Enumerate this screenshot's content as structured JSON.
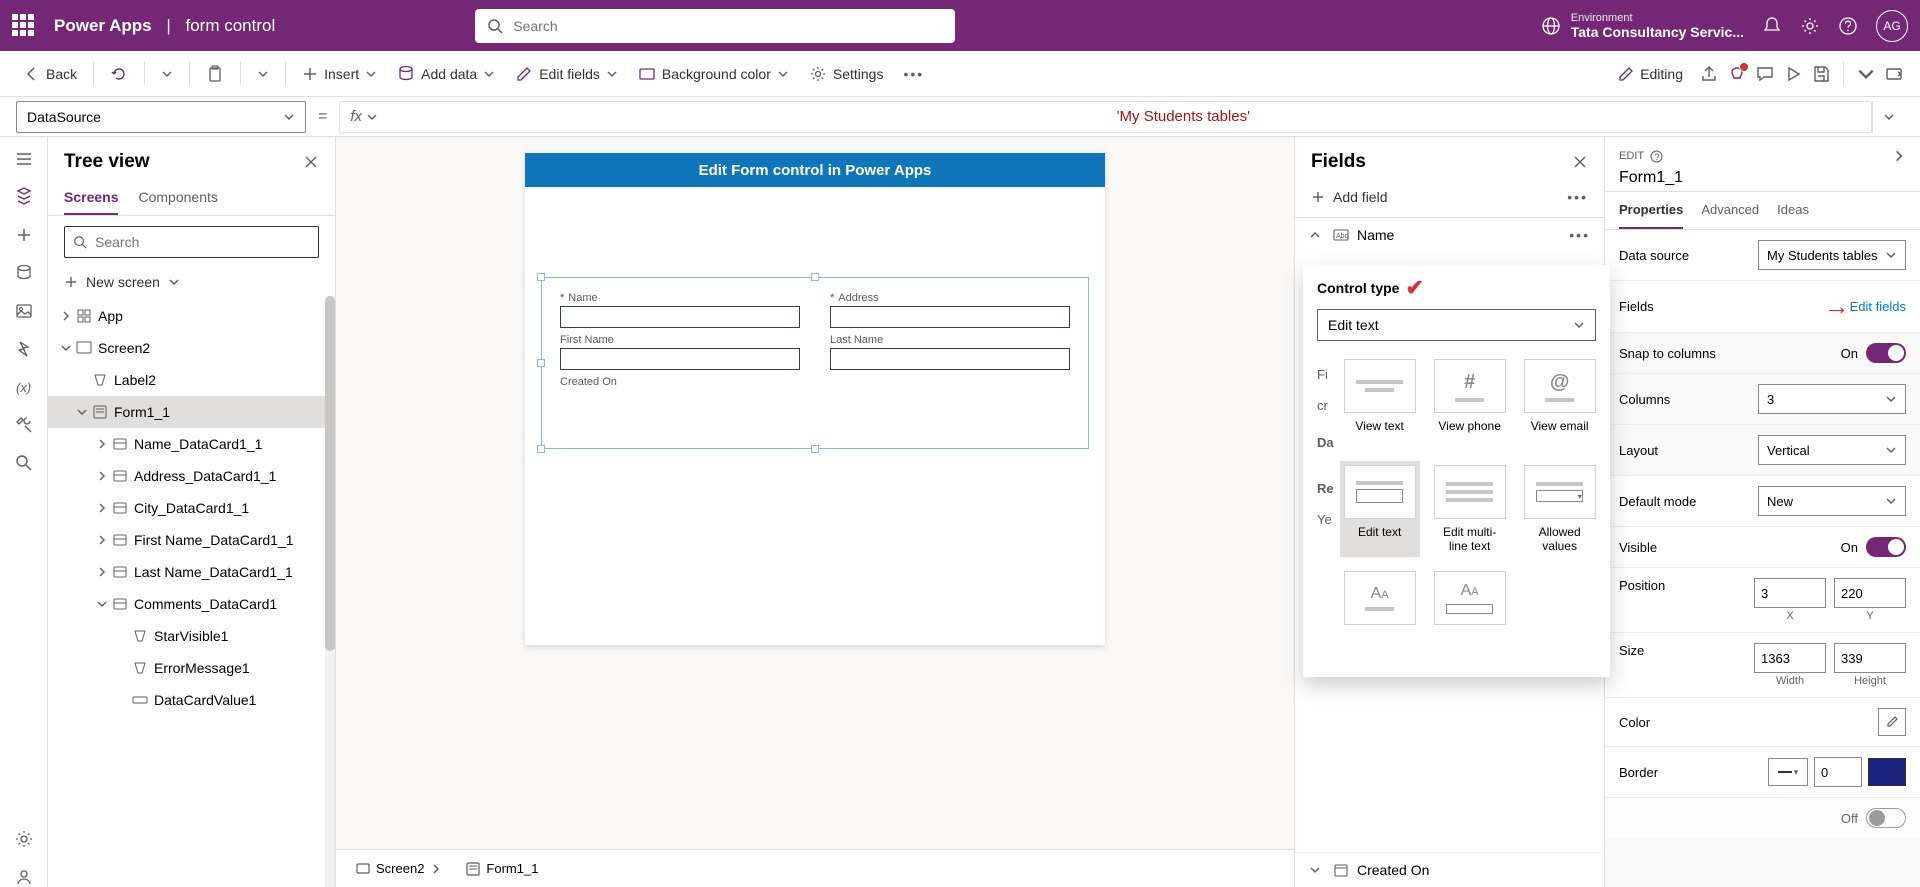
{
  "header": {
    "brand": "Power Apps",
    "page": "form control",
    "search_placeholder": "Search",
    "env_label": "Environment",
    "env_name": "Tata Consultancy Servic...",
    "avatar": "AG"
  },
  "cmdbar": {
    "back": "Back",
    "insert": "Insert",
    "add_data": "Add data",
    "edit_fields": "Edit fields",
    "bg_color": "Background color",
    "settings": "Settings",
    "editing": "Editing"
  },
  "fxbar": {
    "prop": "DataSource",
    "formula": "'My Students tables'"
  },
  "treeview": {
    "title": "Tree view",
    "tabs": [
      "Screens",
      "Components"
    ],
    "search_placeholder": "Search",
    "new_screen": "New screen",
    "nodes": [
      {
        "label": "App",
        "indent": 0,
        "chev": "right",
        "icon": "app"
      },
      {
        "label": "Screen2",
        "indent": 0,
        "chev": "down",
        "icon": "screen"
      },
      {
        "label": "Label2",
        "indent": 1,
        "chev": "none",
        "icon": "label"
      },
      {
        "label": "Form1_1",
        "indent": 1,
        "chev": "down",
        "icon": "form",
        "sel": true
      },
      {
        "label": "Name_DataCard1_1",
        "indent": 2,
        "chev": "right",
        "icon": "card"
      },
      {
        "label": "Address_DataCard1_1",
        "indent": 2,
        "chev": "right",
        "icon": "card"
      },
      {
        "label": "City_DataCard1_1",
        "indent": 2,
        "chev": "right",
        "icon": "card"
      },
      {
        "label": "First Name_DataCard1_1",
        "indent": 2,
        "chev": "right",
        "icon": "card"
      },
      {
        "label": "Last Name_DataCard1_1",
        "indent": 2,
        "chev": "right",
        "icon": "card"
      },
      {
        "label": "Comments_DataCard1",
        "indent": 2,
        "chev": "down",
        "icon": "card"
      },
      {
        "label": "StarVisible1",
        "indent": 3,
        "chev": "none",
        "icon": "label"
      },
      {
        "label": "ErrorMessage1",
        "indent": 3,
        "chev": "none",
        "icon": "label"
      },
      {
        "label": "DataCardValue1",
        "indent": 3,
        "chev": "none",
        "icon": "input"
      }
    ]
  },
  "canvas": {
    "header": "Edit Form control in Power Apps",
    "fields": [
      {
        "label": "Name",
        "required": true
      },
      {
        "label": "Address",
        "required": true
      },
      {
        "label": "First Name",
        "required": false
      },
      {
        "label": "Last Name",
        "required": false
      },
      {
        "label": "Created On",
        "required": false
      }
    ]
  },
  "bottom": {
    "crumb1": "Screen2",
    "crumb2": "Form1_1"
  },
  "fieldspane": {
    "title": "Fields",
    "add": "Add field",
    "name_row": "Name",
    "control_type_label": "Control type",
    "control_type_value": "Edit text",
    "hidden_labels": [
      "Fi",
      "cr",
      "Da",
      "Re",
      "Ye"
    ],
    "tiles": [
      "View text",
      "View phone",
      "View email",
      "Edit text",
      "Edit multi-line text",
      "Allowed values"
    ],
    "collapsed": [
      "Created On"
    ]
  },
  "props": {
    "edit": "EDIT",
    "name": "Form1_1",
    "tabs": [
      "Properties",
      "Advanced",
      "Ideas"
    ],
    "data_source_label": "Data source",
    "data_source_value": "My Students tables",
    "fields_label": "Fields",
    "edit_fields_link": "Edit fields",
    "snap_label": "Snap to columns",
    "snap_on": "On",
    "columns_label": "Columns",
    "columns_value": "3",
    "layout_label": "Layout",
    "layout_value": "Vertical",
    "default_mode_label": "Default mode",
    "default_mode_value": "New",
    "visible_label": "Visible",
    "visible_on": "On",
    "position_label": "Position",
    "pos_x": "3",
    "pos_y": "220",
    "x_label": "X",
    "y_label": "Y",
    "size_label": "Size",
    "width": "1363",
    "height": "339",
    "w_label": "Width",
    "h_label": "Height",
    "color_label": "Color",
    "border_label": "Border",
    "border_value": "0",
    "border_color": "#1a237e",
    "off_label": "Off"
  }
}
